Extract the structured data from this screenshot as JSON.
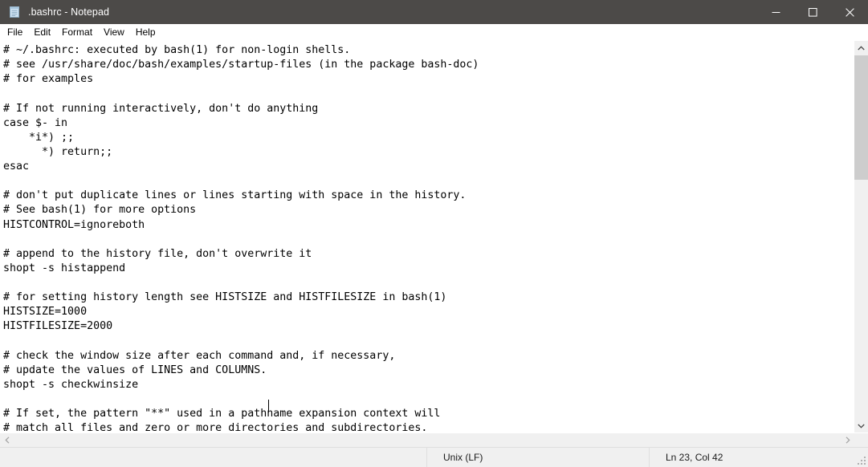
{
  "window": {
    "title": ".bashrc - Notepad",
    "icon": "notepad-icon",
    "titlebar_color": "#4c4a48",
    "controls": {
      "minimize": "Minimize",
      "maximize": "Maximize",
      "close": "Close"
    }
  },
  "menubar": {
    "items": [
      {
        "label": "File"
      },
      {
        "label": "Edit"
      },
      {
        "label": "Format"
      },
      {
        "label": "View"
      },
      {
        "label": "Help"
      }
    ]
  },
  "editor": {
    "content": "# ~/.bashrc: executed by bash(1) for non-login shells.\n# see /usr/share/doc/bash/examples/startup-files (in the package bash-doc)\n# for examples\n\n# If not running interactively, don't do anything\ncase $- in\n    *i*) ;;\n      *) return;;\nesac\n\n# don't put duplicate lines or lines starting with space in the history.\n# See bash(1) for more options\nHISTCONTROL=ignoreboth\n\n# append to the history file, don't overwrite it\nshopt -s histappend\n\n# for setting history length see HISTSIZE and HISTFILESIZE in bash(1)\nHISTSIZE=1000\nHISTFILESIZE=2000\n\n# check the window size after each command and, if necessary,\n# update the values of LINES and COLUMNS.\nshopt -s checkwinsize\n\n# If set, the pattern \"**\" used in a pathname expansion context will\n# match all files and zero or more directories and subdirectories.",
    "caret_line": 23,
    "caret_column": 42,
    "text_color": "#000000",
    "background": "#ffffff"
  },
  "scrollbars": {
    "vertical": {
      "up_arrow": "scroll-up",
      "down_arrow": "scroll-down",
      "thumb_top_pct": 4,
      "thumb_height_pct": 33
    },
    "horizontal": {
      "left_arrow": "scroll-left",
      "right_arrow": "scroll-right"
    }
  },
  "statusbar": {
    "zoom": "",
    "line_ending": "Unix (LF)",
    "position": "Ln 23, Col 42"
  }
}
